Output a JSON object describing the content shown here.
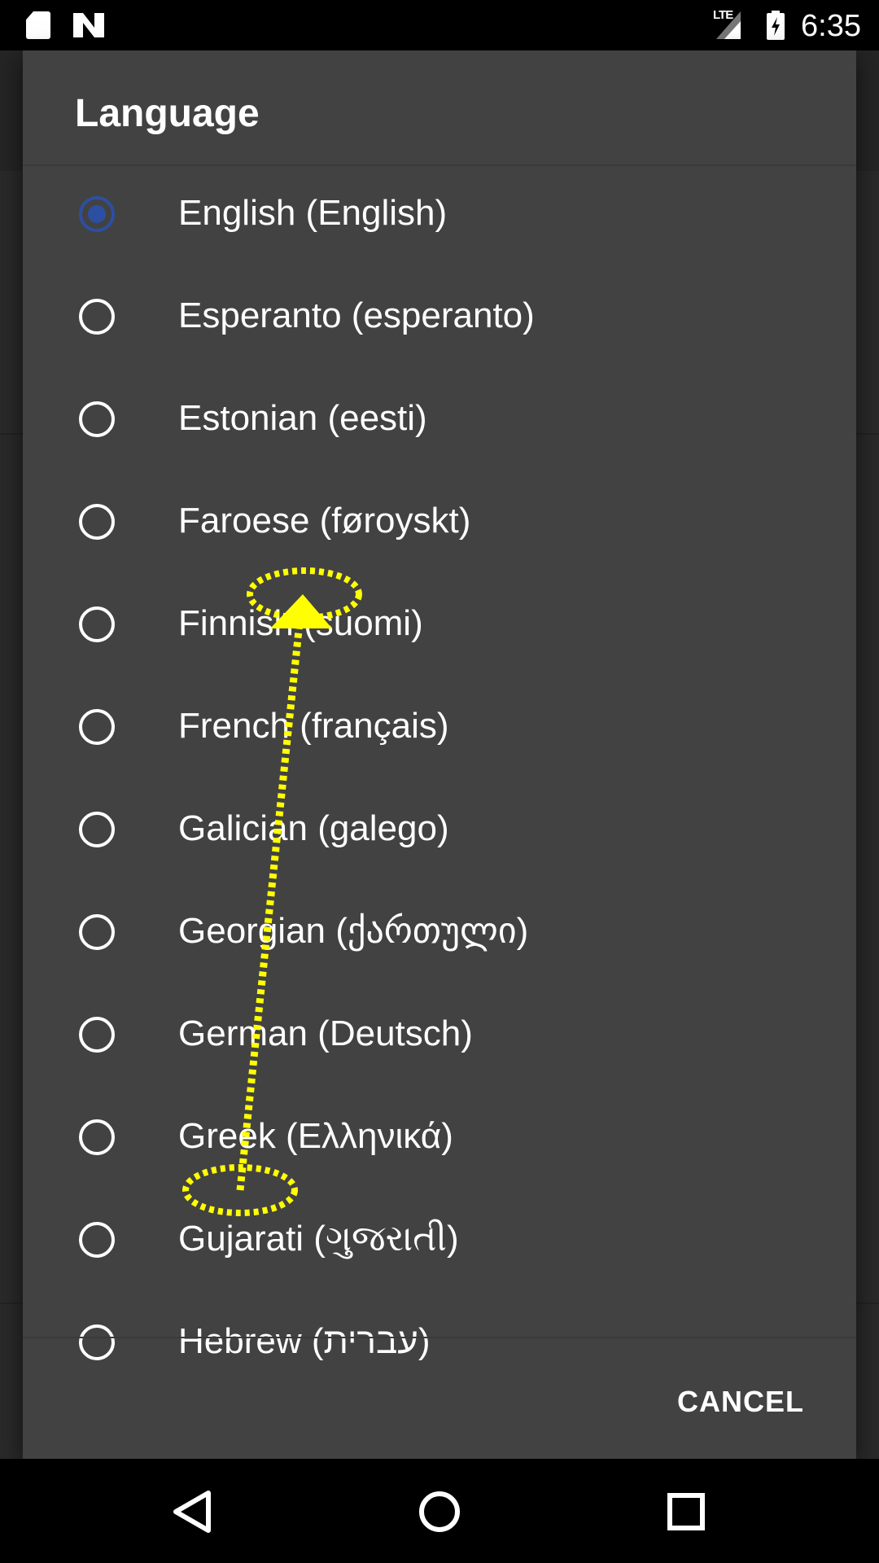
{
  "status_bar": {
    "time": "6:35",
    "network": "LTE"
  },
  "dialog": {
    "title": "Language",
    "selected_index": 0,
    "options": [
      {
        "label": "English (English)",
        "checked": true
      },
      {
        "label": "Esperanto (esperanto)",
        "checked": false
      },
      {
        "label": "Estonian (eesti)",
        "checked": false
      },
      {
        "label": "Faroese (føroyskt)",
        "checked": false
      },
      {
        "label": "Finnish (suomi)",
        "checked": false
      },
      {
        "label": "French (français)",
        "checked": false
      },
      {
        "label": "Galician (galego)",
        "checked": false
      },
      {
        "label": "Georgian (ქართული)",
        "checked": false
      },
      {
        "label": "German (Deutsch)",
        "checked": false
      },
      {
        "label": "Greek (Ελληνικά)",
        "checked": false
      },
      {
        "label": "Gujarati (ગુજરાતી)",
        "checked": false
      },
      {
        "label": "Hebrew (עברית)",
        "checked": false
      }
    ],
    "cancel_label": "CANCEL"
  },
  "colors": {
    "dialog_bg": "#424242",
    "accent": "#2d4fa2",
    "gesture_overlay": "#ffff00"
  },
  "nav_bar": {
    "icons": [
      "back-triangle-icon",
      "home-circle-icon",
      "recents-square-icon"
    ]
  },
  "gesture_overlay": {
    "type": "swipe-up",
    "icons": [
      "start-ellipse-icon",
      "end-ellipse-icon",
      "arrow-icon"
    ]
  }
}
